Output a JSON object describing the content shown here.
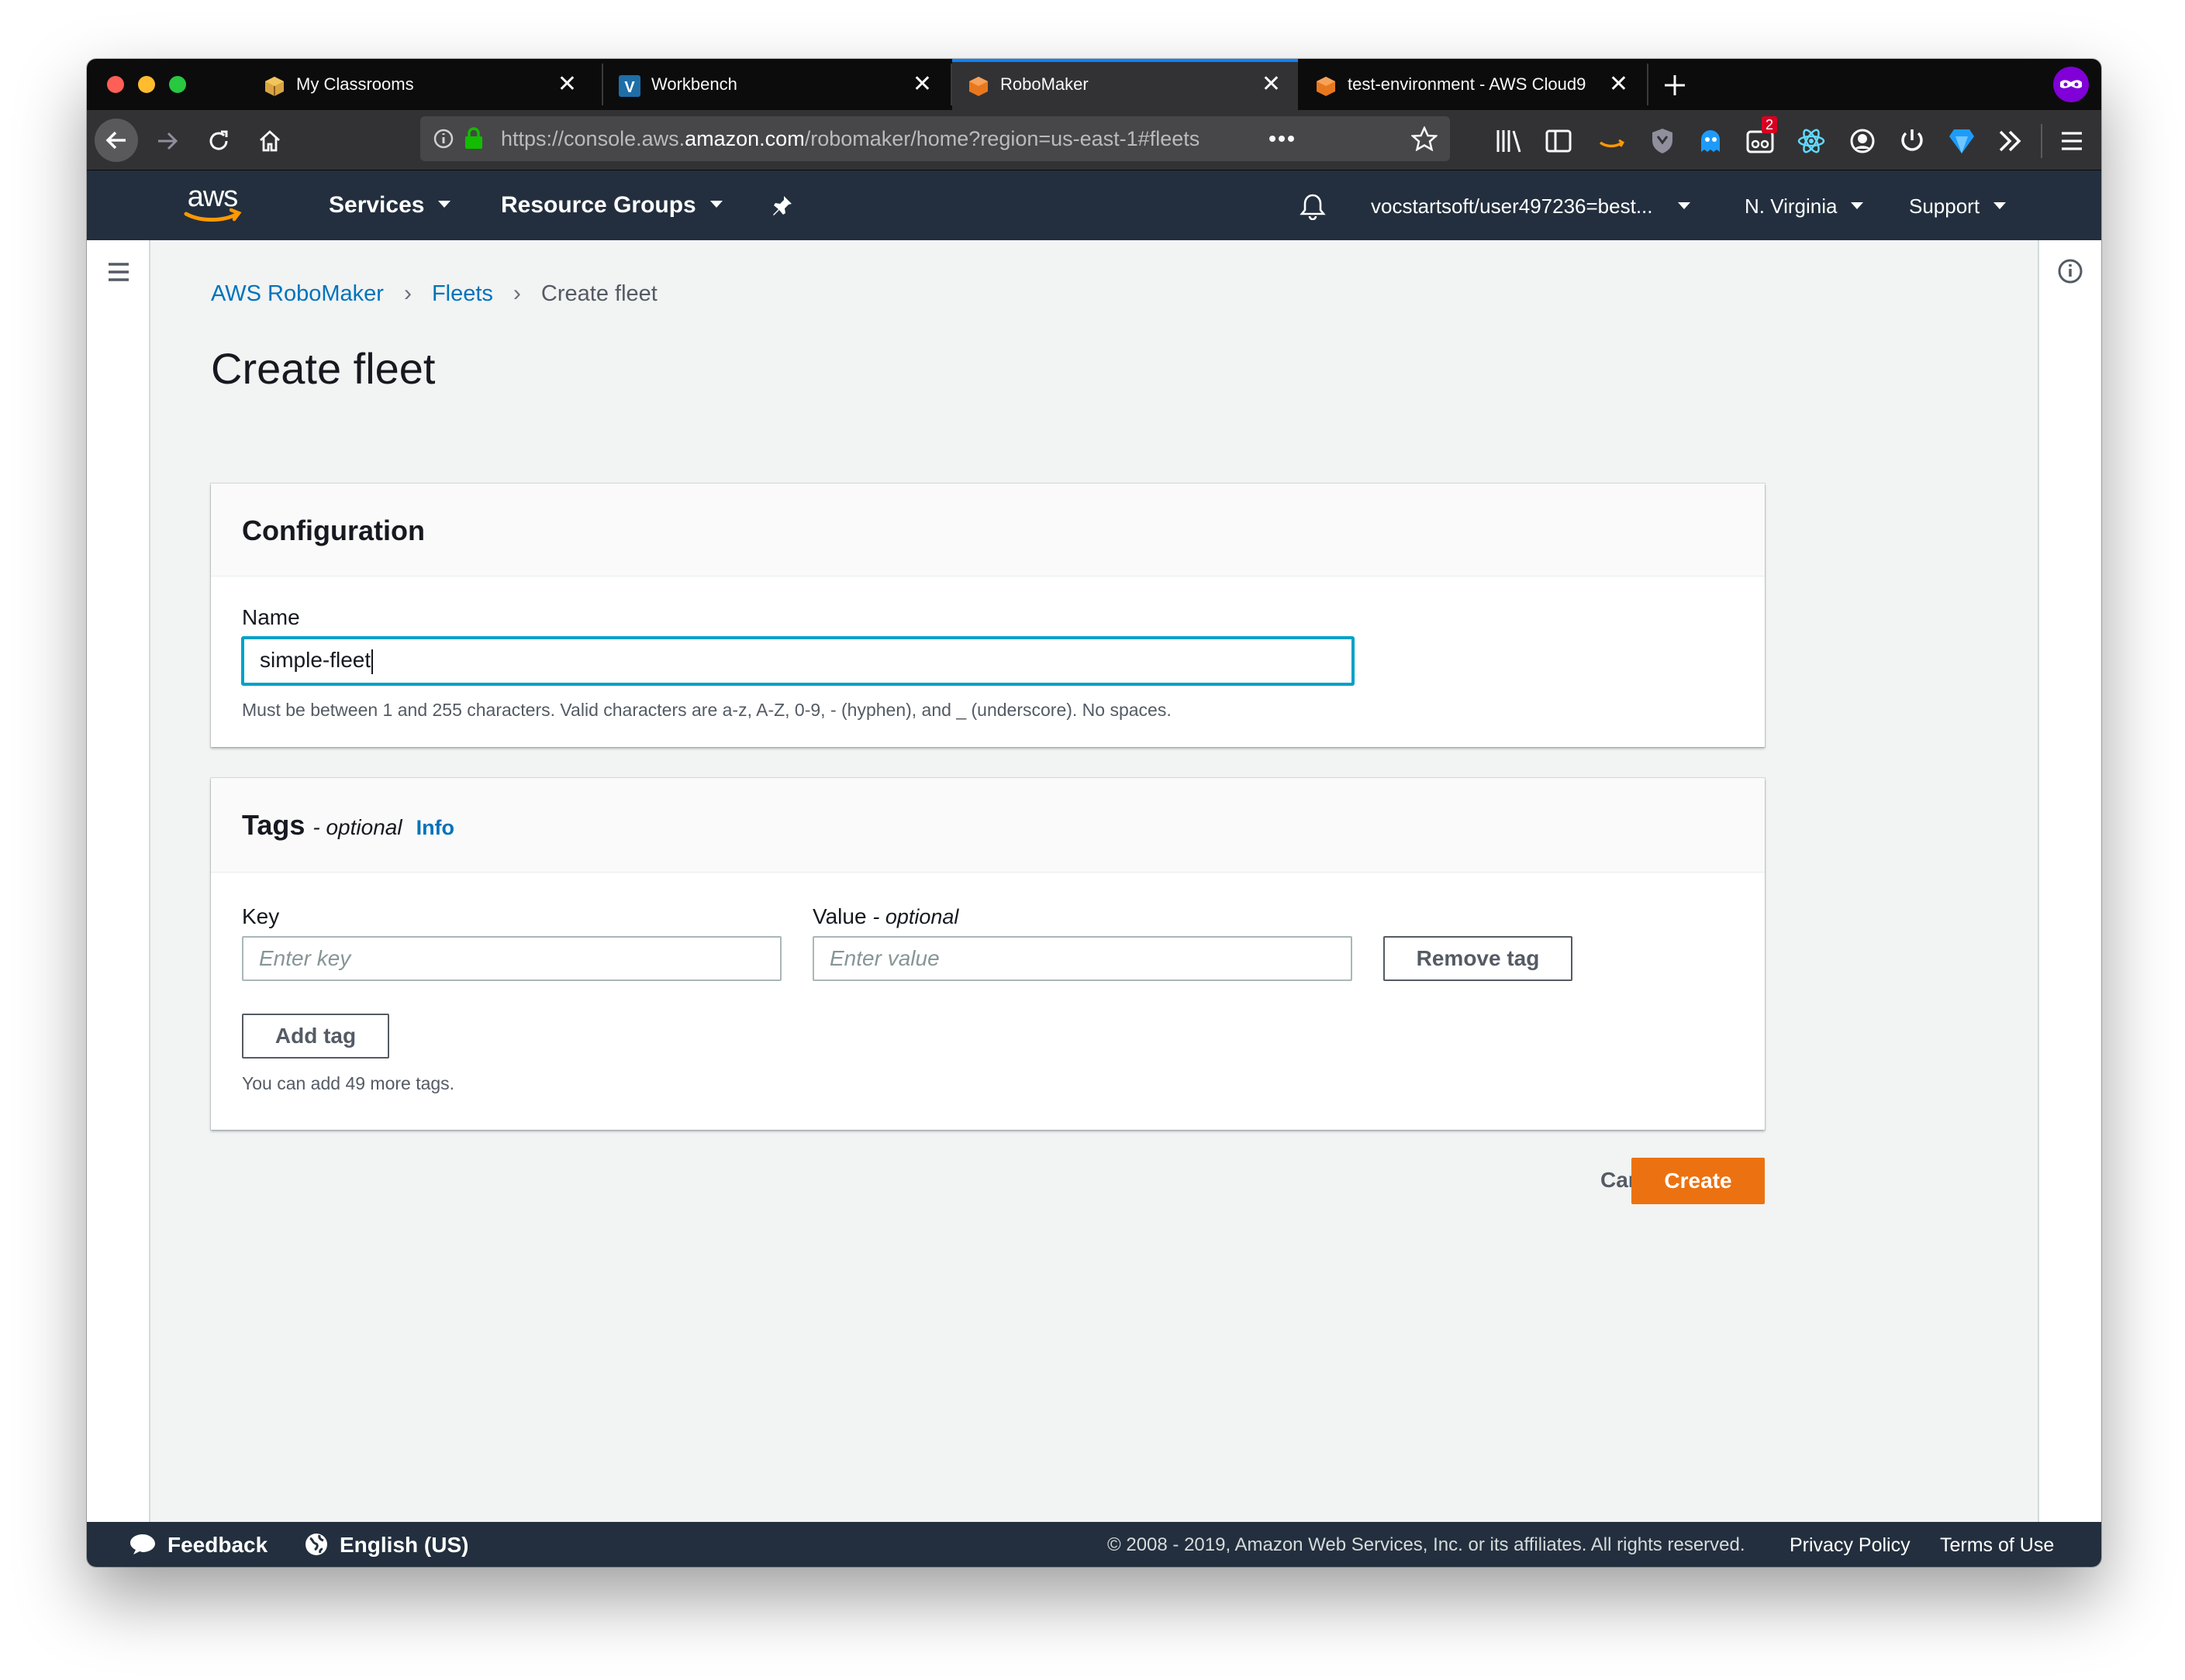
{
  "browser": {
    "tabs": [
      {
        "title": "My Classrooms",
        "icon": "package-icon"
      },
      {
        "title": "Workbench",
        "icon": "vocareum-icon"
      },
      {
        "title": "RoboMaker",
        "icon": "robomaker-icon",
        "active": true
      },
      {
        "title": "test-environment - AWS Cloud9",
        "icon": "cloud9-icon"
      }
    ],
    "url_prefix": "https://console.aws.",
    "url_domain": "amazon.com",
    "url_path": "/robomaker/home?region=us-east-1#fleets",
    "notification_count": "2"
  },
  "aws_header": {
    "services": "Services",
    "resource_groups": "Resource Groups",
    "account": "vocstartsoft/user497236=best...",
    "region": "N. Virginia",
    "support": "Support"
  },
  "breadcrumb": {
    "root": "AWS RoboMaker",
    "parent": "Fleets",
    "current": "Create fleet"
  },
  "page_title": "Create fleet",
  "configuration": {
    "title": "Configuration",
    "name_label": "Name",
    "name_value": "simple-fleet",
    "name_hint": "Must be between 1 and 255 characters. Valid characters are a-z, A-Z, 0-9, - (hyphen), and _ (underscore). No spaces."
  },
  "tags": {
    "title": "Tags",
    "optional": "- optional",
    "info": "Info",
    "key_label": "Key",
    "key_placeholder": "Enter key",
    "value_label": "Value",
    "value_optional": "- optional",
    "value_placeholder": "Enter value",
    "remove_button": "Remove tag",
    "add_button": "Add tag",
    "remaining_hint": "You can add 49 more tags."
  },
  "actions": {
    "cancel": "Cancel",
    "create": "Create"
  },
  "footer": {
    "feedback": "Feedback",
    "language": "English (US)",
    "copyright": "© 2008 - 2019, Amazon Web Services, Inc. or its affiliates. All rights reserved.",
    "privacy": "Privacy Policy",
    "terms": "Terms of Use"
  },
  "colors": {
    "aws_header": "#232f3e",
    "primary_button": "#ec7211",
    "link": "#0073bb",
    "focus": "#00a1c9"
  }
}
